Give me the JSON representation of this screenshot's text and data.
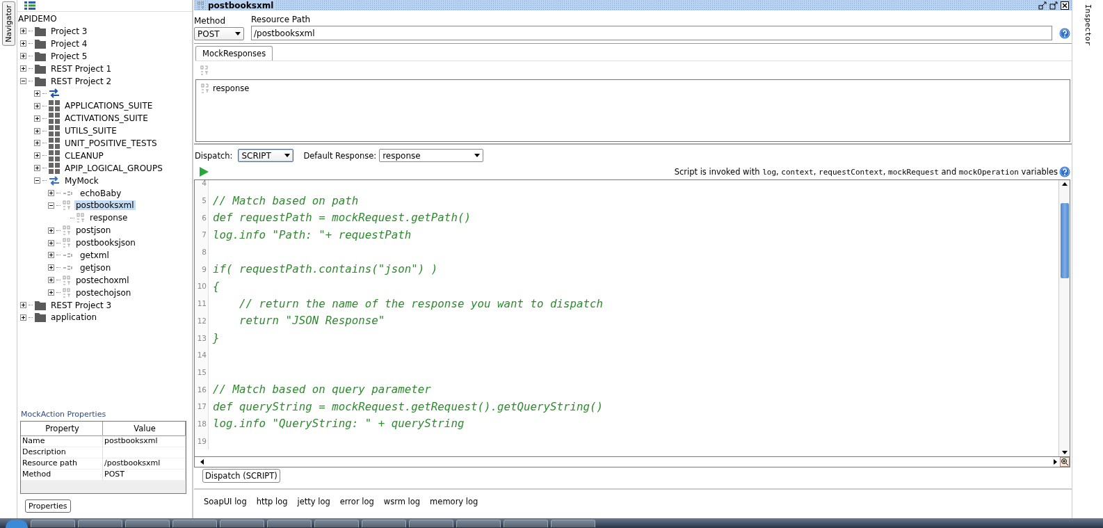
{
  "navigator": {
    "tab": "Navigator",
    "root": "APIDEMO",
    "tree": [
      {
        "label": "Project 3",
        "kind": "folder",
        "expanded": false
      },
      {
        "label": "Project 4",
        "kind": "folder",
        "expanded": false
      },
      {
        "label": "Project 5",
        "kind": "folder",
        "expanded": false
      },
      {
        "label": "REST Project 1",
        "kind": "folder",
        "expanded": false
      },
      {
        "label": "REST Project 2",
        "kind": "folder",
        "expanded": true,
        "children": [
          {
            "kind": "swap",
            "expanded": false
          },
          {
            "label": "APPLICATIONS_SUITE",
            "kind": "suite",
            "expanded": false
          },
          {
            "label": "ACTIVATIONS_SUITE",
            "kind": "suite",
            "expanded": false
          },
          {
            "label": "UTILS_SUITE",
            "kind": "suite",
            "expanded": false
          },
          {
            "label": "UNIT_POSITIVE_TESTS",
            "kind": "suite",
            "expanded": false
          },
          {
            "label": "CLEANUP",
            "kind": "suite",
            "expanded": false
          },
          {
            "label": "APIP_LOGICAL_GROUPS",
            "kind": "suite",
            "expanded": false
          },
          {
            "label": "MyMock",
            "kind": "mock",
            "expanded": true,
            "children": [
              {
                "label": "echoBaby",
                "kind": "get",
                "expanded": false,
                "selected": false
              },
              {
                "label": "postbooksxml",
                "kind": "post",
                "expanded": true,
                "selected": true,
                "children": [
                  {
                    "label": "response",
                    "kind": "rest",
                    "selected": false
                  }
                ]
              },
              {
                "label": "postjson",
                "kind": "post",
                "expanded": false,
                "selected": false
              },
              {
                "label": "postbooksjson",
                "kind": "post",
                "expanded": false,
                "selected": false
              },
              {
                "label": "getxml",
                "kind": "get",
                "expanded": false,
                "selected": false
              },
              {
                "label": "getjson",
                "kind": "get",
                "expanded": false,
                "selected": false
              },
              {
                "label": "postechoxml",
                "kind": "post",
                "expanded": false,
                "selected": false
              },
              {
                "label": "postechojson",
                "kind": "post",
                "expanded": false,
                "selected": false
              }
            ]
          }
        ]
      },
      {
        "label": "REST Project 3",
        "kind": "folder",
        "expanded": false
      },
      {
        "label": "application",
        "kind": "folder",
        "expanded": false
      }
    ]
  },
  "properties": {
    "title": "MockAction Properties",
    "columns": [
      "Property",
      "Value"
    ],
    "rows": [
      [
        "Name",
        "postbooksxml"
      ],
      [
        "Description"
      ],
      [
        "Resource path",
        "/postbooksxml"
      ],
      [
        "Method",
        "POST"
      ]
    ],
    "button": "Properties"
  },
  "editor": {
    "title": "postbooksxml",
    "method_label": "Method",
    "method": "POST",
    "path_label": "Resource Path",
    "path": "/postbooksxml",
    "tabs": [
      {
        "label": "MockResponses",
        "selected": true
      }
    ],
    "responses": [
      {
        "name": "response"
      }
    ],
    "dispatch_label": "Dispatch:",
    "dispatch": "SCRIPT",
    "default_label": "Default Response:",
    "default": "response",
    "script_note": [
      {
        "kind": "text",
        "text": "Script is invoked with "
      },
      {
        "kind": "code",
        "text": "log"
      },
      {
        "kind": "text",
        "text": ", "
      },
      {
        "kind": "code",
        "text": "context"
      },
      {
        "kind": "text",
        "text": ", "
      },
      {
        "kind": "code",
        "text": "requestContext"
      },
      {
        "kind": "text",
        "text": ", "
      },
      {
        "kind": "code",
        "text": "mockRequest"
      },
      {
        "kind": "text",
        "text": " and "
      },
      {
        "kind": "code",
        "text": "mockOperation"
      },
      {
        "kind": "text",
        "text": " variables"
      }
    ],
    "code": [
      {
        "n": "4"
      },
      {
        "n": "5",
        "text": "// Match based on path"
      },
      {
        "n": "6",
        "text": "def requestPath = mockRequest.getPath()"
      },
      {
        "n": "7",
        "text": "log.info \"Path: \"+ requestPath"
      },
      {
        "n": "8"
      },
      {
        "n": "9",
        "text": "if( requestPath.contains(\"json\") )"
      },
      {
        "n": "10",
        "text": "{"
      },
      {
        "n": "11",
        "text": "    // return the name of the response you want to dispatch"
      },
      {
        "n": "12",
        "text": "    return \"JSON Response\""
      },
      {
        "n": "13",
        "text": "}"
      },
      {
        "n": "14"
      },
      {
        "n": "15"
      },
      {
        "n": "16",
        "text": "// Match based on query parameter"
      },
      {
        "n": "17",
        "text": "def queryString = mockRequest.getRequest().getQueryString()"
      },
      {
        "n": "18",
        "text": "log.info \"QueryString: \" + queryString"
      },
      {
        "n": "19"
      }
    ],
    "bottom_tab": "Dispatch (SCRIPT)"
  },
  "logs": [
    "SoapUI log",
    "http log",
    "jetty log",
    "error log",
    "wsrm log",
    "memory log"
  ],
  "inspector_tab": "Inspector"
}
